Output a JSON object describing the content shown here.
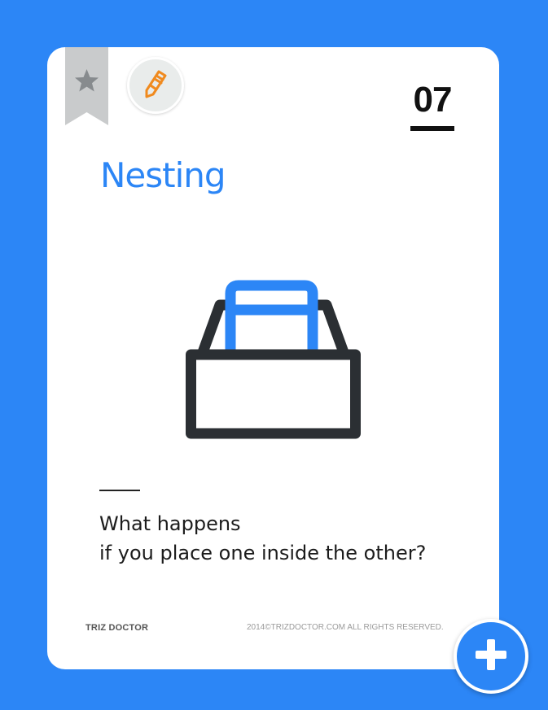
{
  "card": {
    "number": "07",
    "title": "Nesting",
    "question_lines": [
      "What happens",
      "if you place one inside the other?"
    ],
    "brand": "TRIZ DOCTOR",
    "copyright": "2014©TRIZDOCTOR.COM  ALL RIGHTS RESERVED.",
    "illustration": "box-with-nested-box"
  },
  "icons": {
    "bookmark": "star-bookmark-icon",
    "edit": "pencil-icon",
    "fab": "plus-icon"
  },
  "colors": {
    "background": "#2c86f6",
    "card": "#ffffff",
    "accent": "#2c86f6",
    "pencil": "#f08a1e",
    "bookmark": "#c9cbcc",
    "outline": "#2b2f33"
  }
}
